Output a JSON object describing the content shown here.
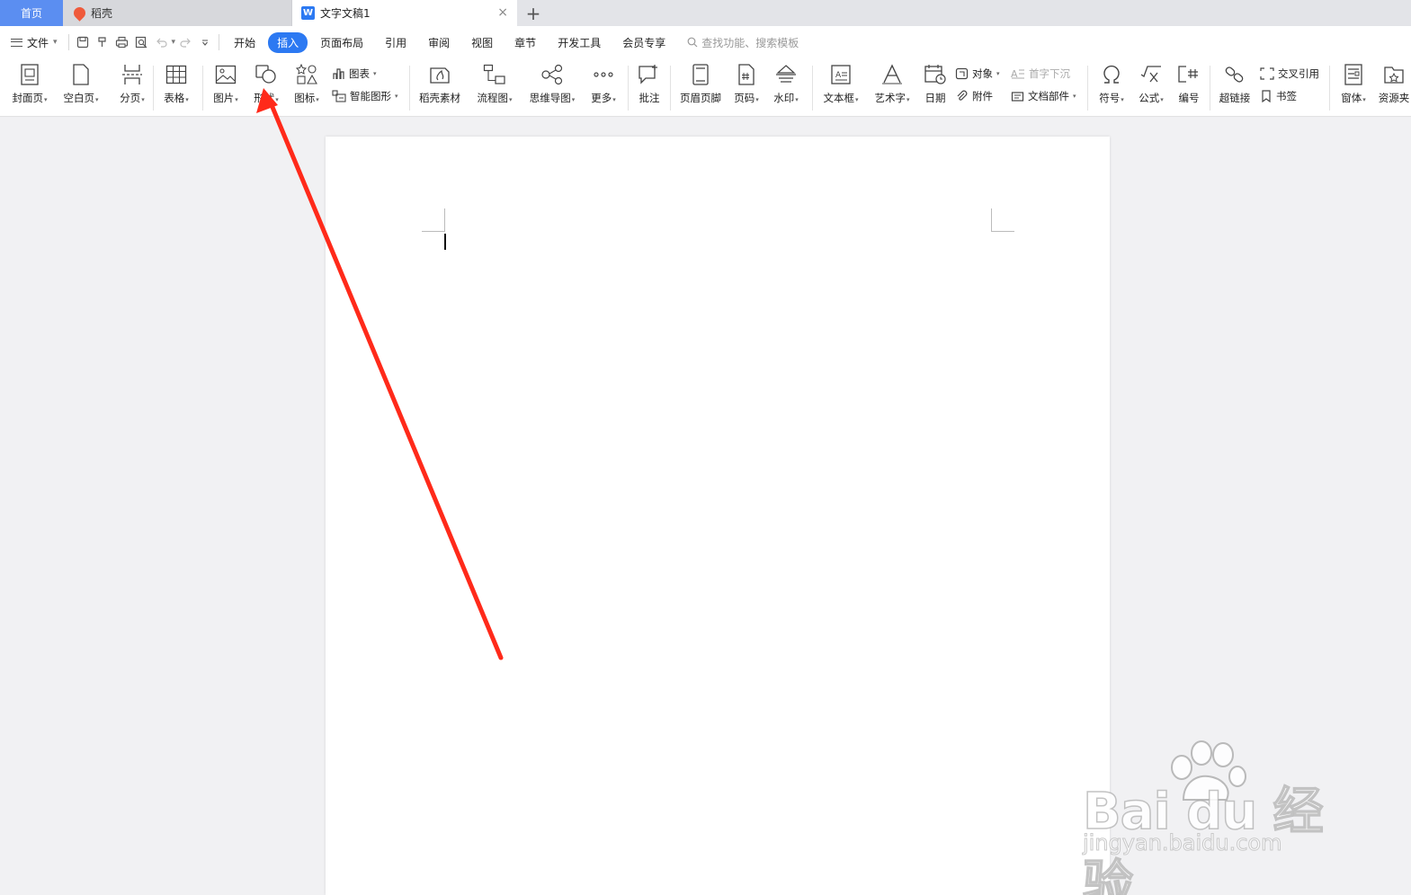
{
  "tabs": {
    "home": "首页",
    "daoke": "稻壳",
    "doc": "文字文稿1",
    "close_glyph": "×",
    "new_glyph": "+",
    "doc_logo_letter": "W"
  },
  "menubar": {
    "file": "文件",
    "tabs": [
      "开始",
      "插入",
      "页面布局",
      "引用",
      "审阅",
      "视图",
      "章节",
      "开发工具",
      "会员专享"
    ],
    "active_tab": "插入",
    "search_placeholder": "查找功能、搜索模板"
  },
  "ribbon": {
    "cover": "封面页",
    "blank": "空白页",
    "pagebreak": "分页",
    "table": "表格",
    "picture": "图片",
    "shape": "形状",
    "icons": "图标",
    "chart": "图表",
    "smartart": "智能图形",
    "daoke_material": "稻壳素材",
    "flowchart": "流程图",
    "mindmap": "思维导图",
    "more": "更多",
    "comment": "批注",
    "header_footer": "页眉页脚",
    "page_number": "页码",
    "watermark": "水印",
    "textbox": "文本框",
    "wordart": "艺术字",
    "date": "日期",
    "object": "对象",
    "attachment": "附件",
    "dropcap": "首字下沉",
    "doc_parts": "文档部件",
    "symbol": "符号",
    "formula": "公式",
    "numbering": "编号",
    "hyperlink": "超链接",
    "cross_ref": "交叉引用",
    "bookmark": "书签",
    "window": "窗体",
    "resource": "资源夹"
  },
  "watermark_brand": {
    "logo": "Bai du 经验",
    "url": "jingyan.baidu.com"
  },
  "colors": {
    "accent": "#2c79f2",
    "home_tab": "#5b8ef1",
    "annotation_arrow": "#ff2a1a"
  }
}
